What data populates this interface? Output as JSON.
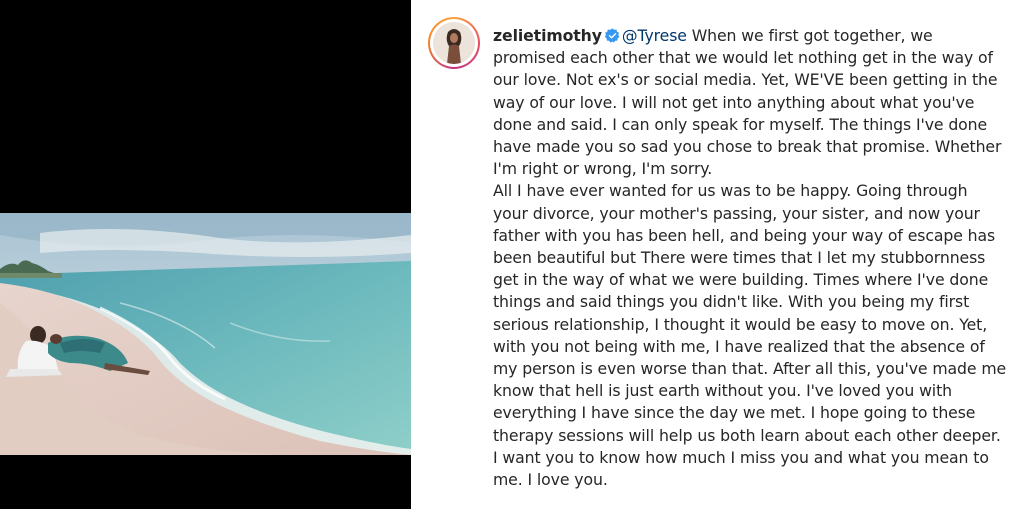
{
  "post": {
    "username": "zelietimothy",
    "verified": true,
    "mention": "@Tyrese",
    "caption_lines": [
      "When we first got together, we",
      "promised each other that we would let nothing get in the way of",
      "our love. Not ex's or social media. Yet, WE'VE been getting in the",
      "way of our love. I will not get into anything about what you've",
      "done and said. I can only speak for myself. The things I've done",
      "have made you so sad you chose to break that promise. Whether",
      "I'm right or wrong, I'm sorry.",
      "All I have ever wanted for us was to be happy. Going through",
      "your divorce, your mother's passing, your sister, and now your",
      "father with you has been hell, and being your way of escape has",
      "been beautiful but There were times that I let my stubbornness",
      "get in the way of what we were building. Times where I've done",
      "things and said things you didn't like. With you being my first",
      "serious relationship, I thought it would be easy to move on. Yet,",
      "with you not being with me, I have realized that the absence of",
      "my person is even worse than that. After all this, you've made me",
      "know that hell is just earth without you. I've loved you with",
      "everything I have since the day we met. I hope going to these",
      "therapy sessions will help us both learn about each other deeper.",
      "I want you to know how much I miss you and what you mean to",
      "me. I love you."
    ]
  },
  "icons": {
    "verified": "verified-badge-icon",
    "avatar": "profile-avatar"
  },
  "colors": {
    "text": "#262626",
    "mention": "#00376b",
    "verified": "#3897f0",
    "media_background": "#000000"
  }
}
